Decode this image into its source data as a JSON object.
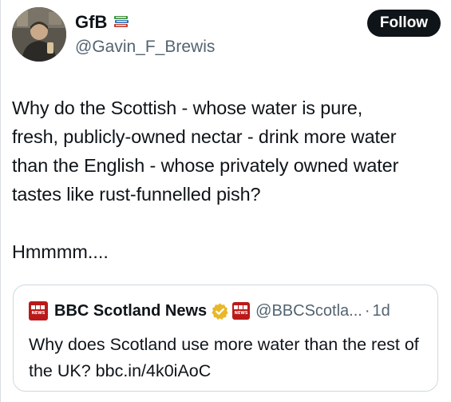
{
  "author": {
    "display_name": "GfB",
    "emoji_icon": "books-icon",
    "handle": "@Gavin_F_Brewis",
    "avatar": "avatar-photo"
  },
  "follow_button": {
    "label": "Follow"
  },
  "tweet": {
    "text_paragraph_1": "Why do the Scottish - whose water is pure,\nfresh, publicly-owned nectar - drink more water\nthan the English - whose privately owned water\ntastes like rust-funnelled pish?",
    "text_paragraph_2": "Hmmmm...."
  },
  "quote": {
    "logo": "bbc-news-logo",
    "name": "BBC Scotland News",
    "verified_icon": "gold-verified-badge-icon",
    "handle": "@BBCScotla...",
    "separator": "·",
    "time": "1d",
    "text": "Why does Scotland use more water than the rest of the UK? bbc.in/4k0iAoC"
  },
  "colors": {
    "text": "#0f1419",
    "secondary": "#536471",
    "follow_bg": "#0f1419",
    "border": "#cfd9de",
    "bbc_red": "#bb1919",
    "verified_gold": "#e8b829"
  }
}
